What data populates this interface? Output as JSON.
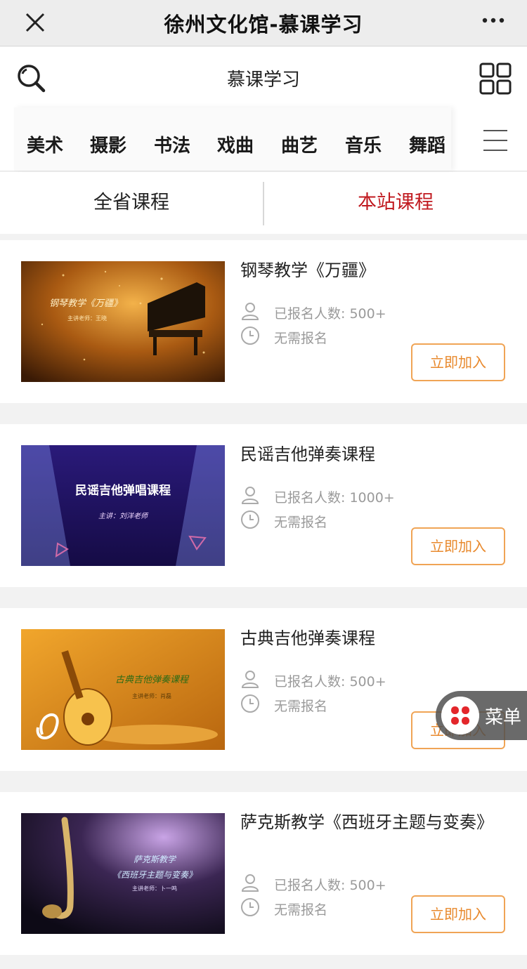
{
  "titlebar": {
    "title": "徐州文化馆-慕课学习"
  },
  "header": {
    "title": "慕课学习"
  },
  "categories": [
    "美术",
    "摄影",
    "书法",
    "戏曲",
    "曲艺",
    "音乐",
    "舞蹈"
  ],
  "tabs": {
    "all": "全省课程",
    "local": "本站课程"
  },
  "colors": {
    "accent_red": "#c0191f",
    "button_orange": "#e8892d"
  },
  "courses": [
    {
      "title": "钢琴教学《万疆》",
      "enrolled": "已报名人数: 500+",
      "signup": "无需报名",
      "button": "立即加入",
      "thumb_text": "钢琴教学《万疆》",
      "thumb_sub": "主讲老师：王晓"
    },
    {
      "title": "民谣吉他弹奏课程",
      "enrolled": "已报名人数: 1000+",
      "signup": "无需报名",
      "button": "立即加入",
      "thumb_text": "民谣吉他弹唱课程",
      "thumb_sub": "主讲：刘洋老师"
    },
    {
      "title": "古典吉他弹奏课程",
      "enrolled": "已报名人数: 500+",
      "signup": "无需报名",
      "button": "立即加入",
      "thumb_text": "古典吉他弹奏课程",
      "thumb_sub": "主讲老师：肖磊"
    },
    {
      "title": "萨克斯教学《西班牙主题与变奏》",
      "enrolled": "已报名人数: 500+",
      "signup": "无需报名",
      "button": "立即加入",
      "thumb_text": "萨克斯教学",
      "thumb_text2": "《西班牙主题与变奏》",
      "thumb_sub": "主讲老师：卜一鸣"
    }
  ],
  "float_menu": {
    "label": "菜单"
  }
}
